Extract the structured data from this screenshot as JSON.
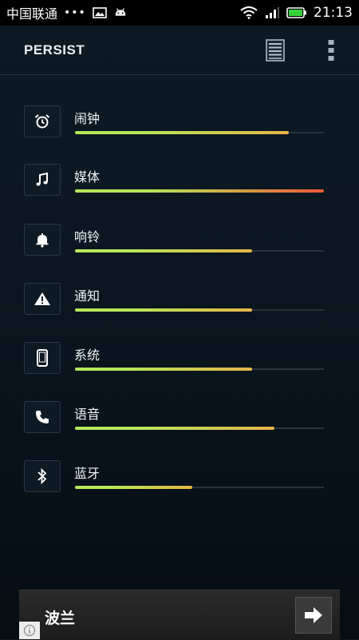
{
  "status_bar": {
    "carrier": "中国联通",
    "dots": "•••",
    "time": "21:13"
  },
  "header": {
    "title": "PERSIST",
    "list_icon": "list-icon",
    "more_icon": "more-vertical-icon"
  },
  "volumes": [
    {
      "label": "闹钟",
      "icon": "alarm-clock-icon",
      "level": 0.86
    },
    {
      "label": "媒体",
      "icon": "music-note-icon",
      "level": 1.0
    },
    {
      "label": "响铃",
      "icon": "bell-icon",
      "level": 0.71
    },
    {
      "label": "通知",
      "icon": "warning-icon",
      "level": 0.71
    },
    {
      "label": "系统",
      "icon": "phone-device-icon",
      "level": 0.71
    },
    {
      "label": "语音",
      "icon": "phone-handset-icon",
      "level": 0.8
    },
    {
      "label": "蓝牙",
      "icon": "bluetooth-icon",
      "level": 0.47
    }
  ],
  "bottom_bar": {
    "location": "波兰",
    "go_icon": "arrow-right-icon",
    "info_icon": "info-icon"
  },
  "colors": {
    "fill_start": "#b6e85a",
    "fill_mid": "#e6b449",
    "fill_end": "#ef5a36"
  }
}
